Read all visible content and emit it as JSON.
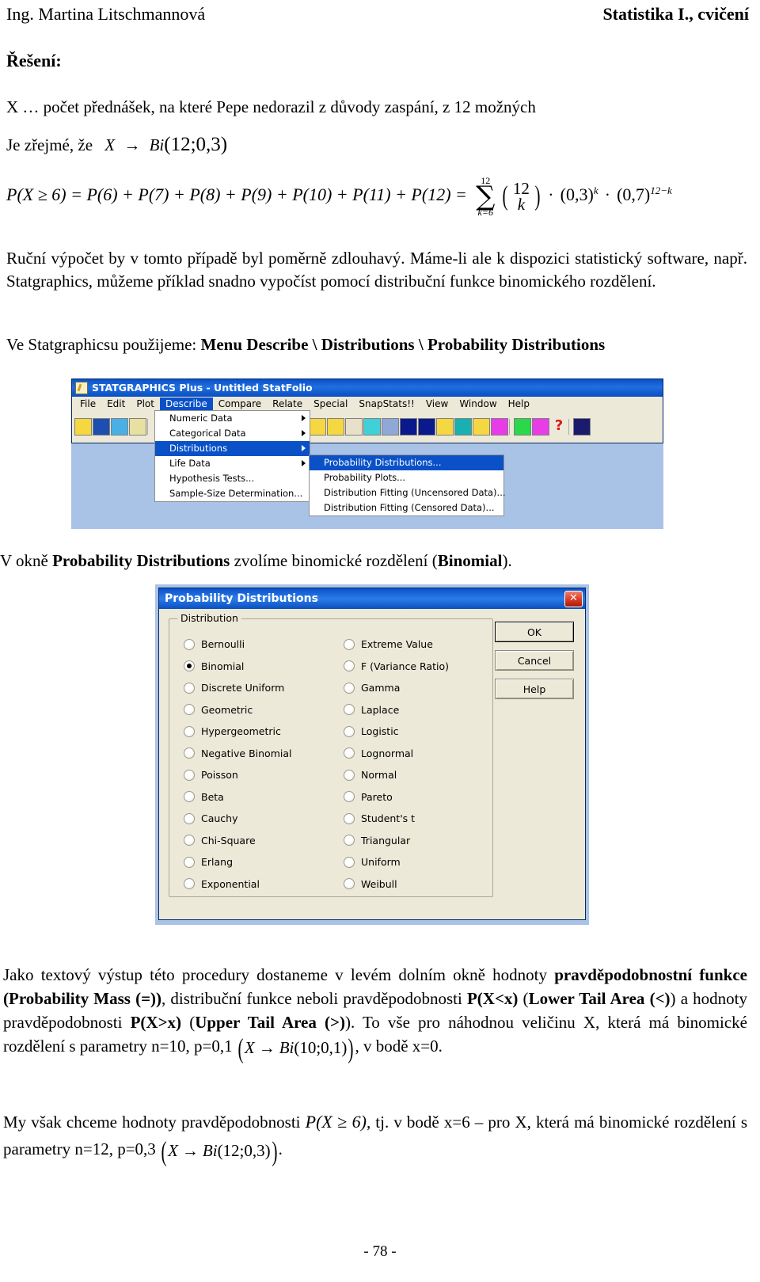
{
  "header": {
    "author": "Ing. Martina Litschmannová",
    "course": "Statistika I., cvičení"
  },
  "section": {
    "solution_label": "Řešení:"
  },
  "intro": {
    "line1": "X … počet přednášek, na které Pepe nedorazil z důvody zaspání, z 12 možných",
    "line2_prefix": "Je zřejmé, že",
    "line2_var": "X",
    "line2_arrow": "→",
    "line2_dist": "Bi",
    "line2_params": "(12;0,3)"
  },
  "formula": {
    "lhs": "P(X ≥ 6) = P(6) + P(7) + P(8) + P(9) + P(10) + P(11) + P(12) =",
    "sum_upper": "12",
    "sum_sigma": "∑",
    "sum_lower": "k=6",
    "binom_top": "12",
    "binom_bottom": "k",
    "factor1": "(0,3)",
    "factor1_exp": "k",
    "dot": "·",
    "factor2": "(0,7)",
    "factor2_exp": "12−k"
  },
  "para1": {
    "text": "Ruční výpočet by v tomto případě byl poměrně zdlouhavý. Máme-li ale k dispozici statistický software, např. Statgraphics, můžeme příklad snadno vypočíst pomocí distribuční funkce binomického rozdělení."
  },
  "menu_path_line": {
    "prefix": "Ve Statgraphicsu použijeme: ",
    "path": "Menu Describe \\ Distributions \\ Probability Distributions"
  },
  "statgraphics": {
    "title": "STATGRAPHICS Plus - Untitled StatFolio",
    "icon": "statfolio-icon",
    "menubar": [
      "File",
      "Edit",
      "Plot",
      "Describe",
      "Compare",
      "Relate",
      "Special",
      "SnapStats!!",
      "View",
      "Window",
      "Help"
    ],
    "active_menu": "Describe",
    "describe_menu": [
      {
        "label": "Numeric Data",
        "submenu": true,
        "selected": false
      },
      {
        "label": "Categorical Data",
        "submenu": true,
        "selected": false
      },
      {
        "label": "Distributions",
        "submenu": true,
        "selected": true
      },
      {
        "label": "Life Data",
        "submenu": true,
        "selected": false
      },
      {
        "label": "Hypothesis Tests...",
        "submenu": false,
        "selected": false
      },
      {
        "label": "Sample-Size Determination...",
        "submenu": false,
        "selected": false
      }
    ],
    "distributions_submenu": [
      {
        "label": "Probability Distributions...",
        "selected": true
      },
      {
        "label": "Probability Plots...",
        "selected": false
      },
      {
        "label": "Distribution Fitting (Uncensored Data)...",
        "selected": false
      },
      {
        "label": "Distribution Fitting (Censored Data)...",
        "selected": false
      }
    ],
    "toolbar_left": [
      {
        "name": "open-folder-icon",
        "color": "#f5d742"
      },
      {
        "name": "save-disk-icon",
        "color": "#1d4fb0"
      },
      {
        "name": "datasheet-icon",
        "color": "#49b0e6"
      },
      {
        "name": "numeric-icon",
        "color": "#e8e0a0"
      }
    ],
    "toolbar_right": [
      {
        "name": "scatterplot-icon",
        "color": "#f5d742"
      },
      {
        "name": "boxplot-icon",
        "color": "#f5d742"
      },
      {
        "name": "histogram-icon",
        "color": "#e8e0c8"
      },
      {
        "name": "sigma-icon",
        "color": "#3fd0d8"
      },
      {
        "name": "regression-icon",
        "color": "#8fa8d8"
      },
      {
        "name": "timeseries-icon",
        "color": "#0a1a8c"
      },
      {
        "name": "normal-curve-icon",
        "color": "#0a1a8c"
      },
      {
        "name": "trend-icon",
        "color": "#f5d742"
      },
      {
        "name": "globe-icon",
        "color": "#18b0b0"
      },
      {
        "name": "flowchart-icon",
        "color": "#f5d742"
      },
      {
        "name": "glm-icon",
        "color": "#e83ce8"
      },
      {
        "name": "question-green-icon",
        "color": "#2ad84a"
      },
      {
        "name": "wizard-icon",
        "color": "#e83ce8"
      },
      {
        "name": "help-question-icon",
        "color": "#d81a1a"
      },
      {
        "name": "grid-icon",
        "color": "#1b1b6e"
      }
    ]
  },
  "dialog_caption": {
    "prefix": "V okně ",
    "bold1": "Probability Distributions",
    "mid": " zvolíme binomické rozdělení (",
    "bold2": "Binomial",
    "suffix": ")."
  },
  "dialog": {
    "title": "Probability Distributions",
    "close_glyph": "✕",
    "group_label": "Distribution",
    "selected": "Binomial",
    "left_options": [
      "Bernoulli",
      "Binomial",
      "Discrete Uniform",
      "Geometric",
      "Hypergeometric",
      "Negative Binomial",
      "Poisson",
      "Beta",
      "Cauchy",
      "Chi-Square",
      "Erlang",
      "Exponential"
    ],
    "right_options": [
      "Extreme Value",
      "F (Variance Ratio)",
      "Gamma",
      "Laplace",
      "Logistic",
      "Lognormal",
      "Normal",
      "Pareto",
      "Student's t",
      "Triangular",
      "Uniform",
      "Weibull"
    ],
    "buttons": [
      "OK",
      "Cancel",
      "Help"
    ]
  },
  "para2": {
    "t1": "Jako textový výstup této procedury dostaneme v levém dolním okně hodnoty ",
    "b1": "pravděpodobnostní funkce (Probability Mass (=))",
    "t2": ", distribuční funkce neboli pravděpodobnosti ",
    "b2": "P(X<x)",
    "t3": " (",
    "b3": "Lower Tail Area (<)",
    "t4": ") a hodnoty pravděpodobnosti ",
    "b4": "P(X>x)",
    "t5": " (",
    "b5": "Upper Tail Area (>)",
    "t6": "). To vše pro náhodnou veličinu X, která má binomické rozdělení s parametry n=10, p=0,1 ",
    "m1_open": "(",
    "m1_var": "X",
    "m1_arrow": "→",
    "m1_dist": "Bi",
    "m1_params": "(10;0,1)",
    "m1_close": ")",
    "t7": ", v bodě x=0."
  },
  "para3": {
    "t1": "My však chceme hodnoty pravděpodobnosti ",
    "m_lhs": "P(X ≥ 6)",
    "t2": ", tj. v bodě x=6 – pro X, která má binomické rozdělení s parametry n=12, p=0,3 ",
    "m2_open": "(",
    "m2_var": "X",
    "m2_arrow": "→",
    "m2_dist": "Bi",
    "m2_params": "(12;0,3)",
    "m2_close": ")",
    "t3": "."
  },
  "footer": {
    "page_number": "- 78 -"
  }
}
